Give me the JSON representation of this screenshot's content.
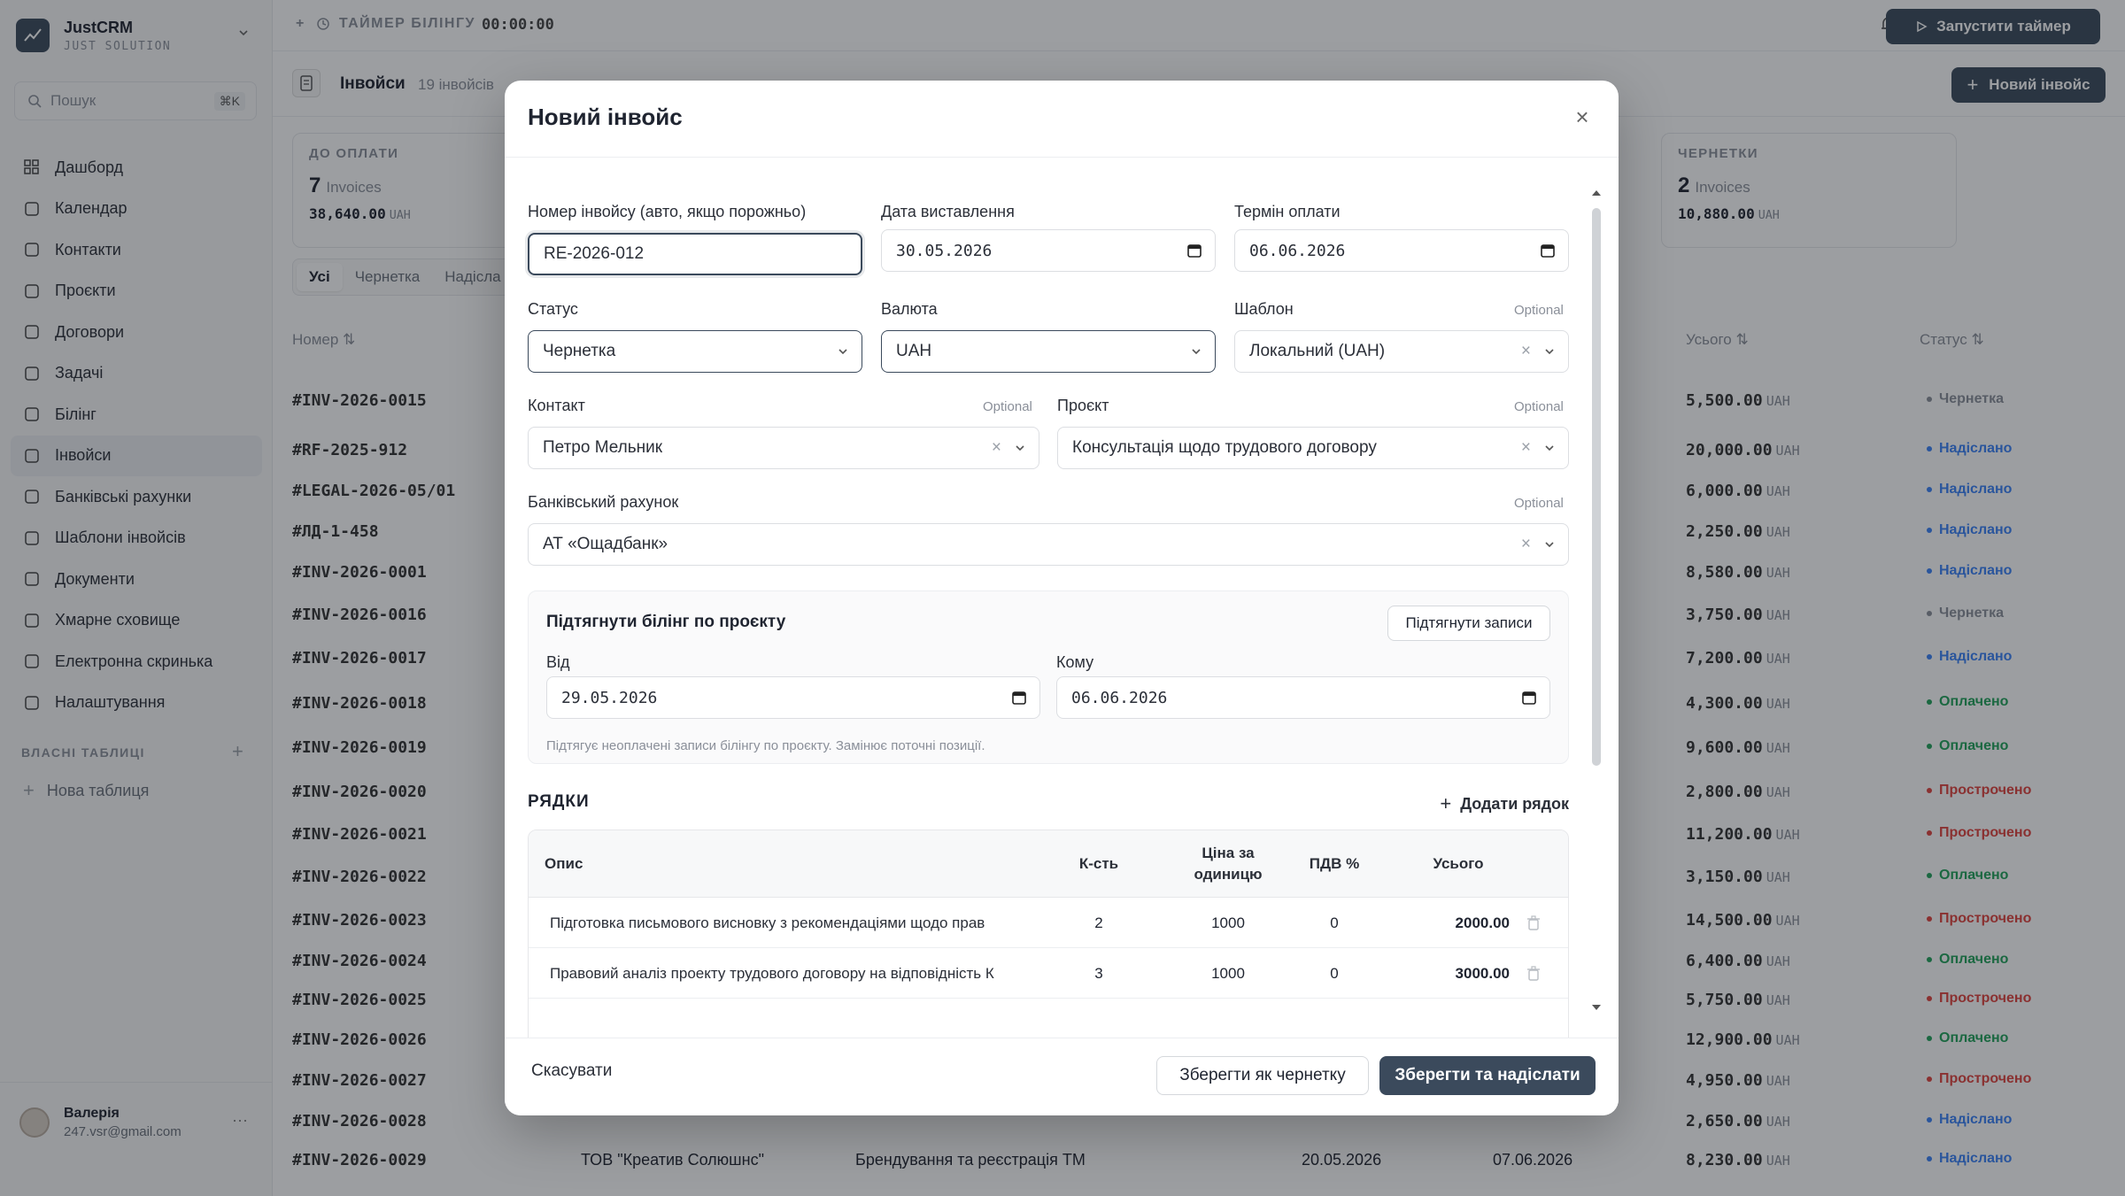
{
  "brand": {
    "name": "JustCRM",
    "sub": "JUST SOLUTION"
  },
  "search": {
    "placeholder": "Пошук",
    "shortcut": "⌘K"
  },
  "nav": [
    {
      "label": "Дашборд",
      "icon": "grid-icon"
    },
    {
      "label": "Календар",
      "icon": "calendar-icon"
    },
    {
      "label": "Контакти",
      "icon": "users-icon"
    },
    {
      "label": "Проєкти",
      "icon": "building-icon"
    },
    {
      "label": "Договори",
      "icon": "file-icon"
    },
    {
      "label": "Задачі",
      "icon": "checkbox-icon"
    },
    {
      "label": "Білінг",
      "icon": "clock-icon"
    },
    {
      "label": "Інвойси",
      "icon": "receipt-icon",
      "active": true
    },
    {
      "label": "Банківські рахунки",
      "icon": "bank-icon"
    },
    {
      "label": "Шаблони інвойсів",
      "icon": "template-icon"
    },
    {
      "label": "Документи",
      "icon": "document-icon"
    },
    {
      "label": "Хмарне сховище",
      "icon": "cloud-icon"
    },
    {
      "label": "Електронна скринька",
      "icon": "mail-icon"
    },
    {
      "label": "Налаштування",
      "icon": "gear-icon"
    }
  ],
  "custom_tables": {
    "title": "ВЛАСНІ ТАБЛИЦІ",
    "new_label": "Нова таблиця"
  },
  "user": {
    "name": "Валерія",
    "email": "247.vsr@gmail.com"
  },
  "topbar": {
    "timer_label": "ТАЙМЕР БІЛІНГУ",
    "timer_value": "00:00:00",
    "start_button": "Запустити таймер"
  },
  "page": {
    "title": "Інвойси",
    "count": "19 інвойсів",
    "new_button": "Новий інвойс"
  },
  "stats": [
    {
      "title": "ДО ОПЛАТИ",
      "count": "7",
      "unit": "Invoices",
      "sum": "38,640.00",
      "currency": "UAH"
    },
    {
      "title": "ЧЕРНЕТКИ",
      "count": "2",
      "unit": "Invoices",
      "sum": "10,880.00",
      "currency": "UAH"
    }
  ],
  "tabs": [
    "Усі",
    "Чернетка",
    "Надісла"
  ],
  "table": {
    "headers": {
      "number": "Номер",
      "total": "Усього",
      "status": "Статус"
    },
    "status_colors": {
      "Чернетка": "#8a8f99",
      "Надіслано": "#3b82f6",
      "Оплачено": "#22a35a",
      "Прострочено": "#e0443e"
    },
    "rows": [
      {
        "num": "#INV-2026-0015",
        "total": "5,500.00",
        "status": "Чернетка"
      },
      {
        "num": "#RF-2025-912",
        "total": "20,000.00",
        "status": "Надіслано"
      },
      {
        "num": "#LEGAL-2026-05/01",
        "total": "6,000.00",
        "status": "Надіслано"
      },
      {
        "num": "#ЛД-1-458",
        "total": "2,250.00",
        "status": "Надіслано"
      },
      {
        "num": "#INV-2026-0001",
        "total": "8,580.00",
        "status": "Надіслано"
      },
      {
        "num": "#INV-2026-0016",
        "total": "3,750.00",
        "status": "Чернетка"
      },
      {
        "num": "#INV-2026-0017",
        "total": "7,200.00",
        "status": "Надіслано"
      },
      {
        "num": "#INV-2026-0018",
        "total": "4,300.00",
        "status": "Оплачено"
      },
      {
        "num": "#INV-2026-0019",
        "total": "9,600.00",
        "status": "Оплачено"
      },
      {
        "num": "#INV-2026-0020",
        "total": "2,800.00",
        "status": "Прострочено"
      },
      {
        "num": "#INV-2026-0021",
        "total": "11,200.00",
        "status": "Прострочено"
      },
      {
        "num": "#INV-2026-0022",
        "total": "3,150.00",
        "status": "Оплачено"
      },
      {
        "num": "#INV-2026-0023",
        "total": "14,500.00",
        "status": "Прострочено"
      },
      {
        "num": "#INV-2026-0024",
        "total": "6,400.00",
        "status": "Оплачено"
      },
      {
        "num": "#INV-2026-0025",
        "total": "5,750.00",
        "status": "Прострочено"
      },
      {
        "num": "#INV-2026-0026",
        "total": "12,900.00",
        "status": "Оплачено"
      },
      {
        "num": "#INV-2026-0027",
        "total": "4,950.00",
        "status": "Прострочено"
      },
      {
        "num": "#INV-2026-0028",
        "total": "2,650.00",
        "status": "Надіслано"
      },
      {
        "num": "#INV-2026-0029",
        "client": "ТОВ \"Креатив Солюшнс\"",
        "project": "Брендування та реєстрація ТМ",
        "issued": "20.05.2026",
        "due": "07.06.2026",
        "total": "8,230.00",
        "status": "Надіслано"
      }
    ],
    "currency": "UAH"
  },
  "modal": {
    "title": "Новий інвойс",
    "number": {
      "label": "Номер інвойсу (авто, якщо порожньо)",
      "value": "RE-2026-012"
    },
    "issue_date": {
      "label": "Дата виставлення",
      "value": "30.05.2026"
    },
    "due_date": {
      "label": "Термін оплати",
      "value": "06.06.2026"
    },
    "status": {
      "label": "Статус",
      "value": "Чернетка"
    },
    "currency": {
      "label": "Валюта",
      "value": "UAH"
    },
    "template": {
      "label": "Шаблон",
      "optional": "Optional",
      "value": "Локальний (UAH)"
    },
    "contact": {
      "label": "Контакт",
      "optional": "Optional",
      "value": "Петро Мельник"
    },
    "project": {
      "label": "Проєкт",
      "optional": "Optional",
      "value": "Консультація щодо трудового договору"
    },
    "bank": {
      "label": "Банківський рахунок",
      "optional": "Optional",
      "value": "АТ «Ощадбанк»"
    },
    "billing": {
      "title": "Підтягнути білінг по проєкту",
      "button": "Підтягнути записи",
      "from_label": "Від",
      "from_value": "29.05.2026",
      "to_label": "Кому",
      "to_value": "06.06.2026",
      "hint": "Підтягує неоплачені записи білінгу по проєкту. Замінює поточні позиції."
    },
    "lines": {
      "title": "РЯДКИ",
      "add": "Додати рядок",
      "headers": {
        "desc": "Опис",
        "qty": "К-сть",
        "price": "Ціна за одиницю",
        "vat": "ПДВ %",
        "total": "Усього"
      },
      "rows": [
        {
          "desc": "Підготовка письмового висновку з рекомендаціями щодо прав",
          "qty": "2",
          "price": "1000",
          "vat": "0",
          "total": "2000.00"
        },
        {
          "desc": "Правовий аналіз проекту трудового договору на відповідність К",
          "qty": "3",
          "price": "1000",
          "vat": "0",
          "total": "3000.00"
        }
      ]
    },
    "footer": {
      "cancel": "Скасувати",
      "draft": "Зберегти як чернетку",
      "send": "Зберегти та надіслати"
    }
  }
}
